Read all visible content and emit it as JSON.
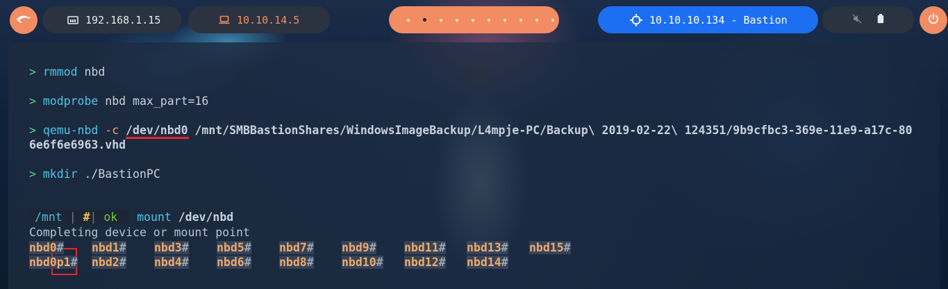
{
  "topbar": {
    "left_ip": "192.168.1.15",
    "vpn_ip": "10.10.14.5",
    "target": "10.10.10.134 - Bastion",
    "workspaces": [
      0,
      1,
      2,
      3,
      4,
      5,
      6,
      7,
      8,
      9
    ],
    "active_workspace": 1
  },
  "terminal": {
    "commands": [
      {
        "prompt": ">",
        "cmd": "rmmod",
        "args": " nbd"
      },
      {
        "prompt": ">",
        "cmd": "modprobe",
        "args": " nbd max_part=16"
      },
      {
        "prompt": ">",
        "cmd": "qemu-nbd",
        "flag": " -c",
        "device": " /dev/nbd0",
        "rest": " /mnt/SMBBastionShares/WindowsImageBackup/L4mpje-PC/Backup\\ 2019-02-22\\ 124351/9b9cfbc3-369e-11e9-a17c-80",
        "wrap": "6e6f6e6963.vhd"
      },
      {
        "prompt": ">",
        "cmd": "mkdir",
        "args": " ./BastionPC"
      }
    ],
    "prompt_bar": {
      "path": "/mnt",
      "sep1": "|",
      "hash": "#",
      "sep2": "|",
      "status": "ok",
      "cmd": "mount",
      "arg": " /dev/nbd"
    },
    "completion_header": "Completing device or mount point",
    "completion_row1": [
      "nbd0#",
      "nbd1#",
      "nbd3#",
      "nbd5#",
      "nbd7#",
      "nbd9#",
      "nbd11#",
      "nbd13#",
      "nbd15#"
    ],
    "completion_row2": [
      "nbd0p1#",
      "nbd2#",
      "nbd4#",
      "nbd6#",
      "nbd8#",
      "nbd10#",
      "nbd12#",
      "nbd14#"
    ]
  },
  "colors": {
    "accent_orange": "#f28c63",
    "accent_blue": "#1d6ff2",
    "highlight_red": "#e8262a"
  },
  "icons": [
    "kali-dragon-icon",
    "network-icon",
    "laptop-icon",
    "crosshair-icon",
    "mute-icon",
    "battery-icon",
    "power-icon"
  ]
}
